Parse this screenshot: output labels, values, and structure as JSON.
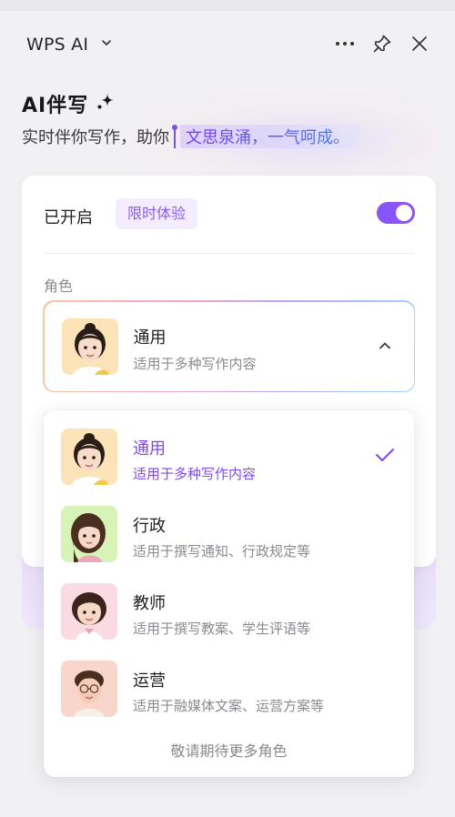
{
  "header": {
    "app_title": "WPS AI",
    "icons": [
      "chevron-down-icon",
      "more-icon",
      "pin-icon",
      "close-icon"
    ]
  },
  "hero": {
    "title": "AI伴写",
    "subtitle_plain": "实时伴你写作，助你",
    "subtitle_highlight": "文思泉涌，一气呵成。",
    "icon": "sparkle-icon"
  },
  "settings": {
    "enabled_label": "已开启",
    "trial_badge": "限时体验",
    "toggle_on": true,
    "role_label": "角色"
  },
  "selected_role": {
    "name": "通用",
    "description": "适用于多种写作内容"
  },
  "role_options": [
    {
      "name": "通用",
      "description": "适用于多种写作内容",
      "selected": true
    },
    {
      "name": "行政",
      "description": "适用于撰写通知、行政规定等",
      "selected": false
    },
    {
      "name": "教师",
      "description": "适用于撰写教案、学生评语等",
      "selected": false
    },
    {
      "name": "运营",
      "description": "适用于融媒体文案、运营方案等",
      "selected": false
    }
  ],
  "more_roles_text": "敬请期待更多角色",
  "colors": {
    "accent": "#8856f6",
    "accent_text": "#7d4af2",
    "badge_bg": "#f3edff",
    "panel_bg": "#f1f1f3"
  }
}
